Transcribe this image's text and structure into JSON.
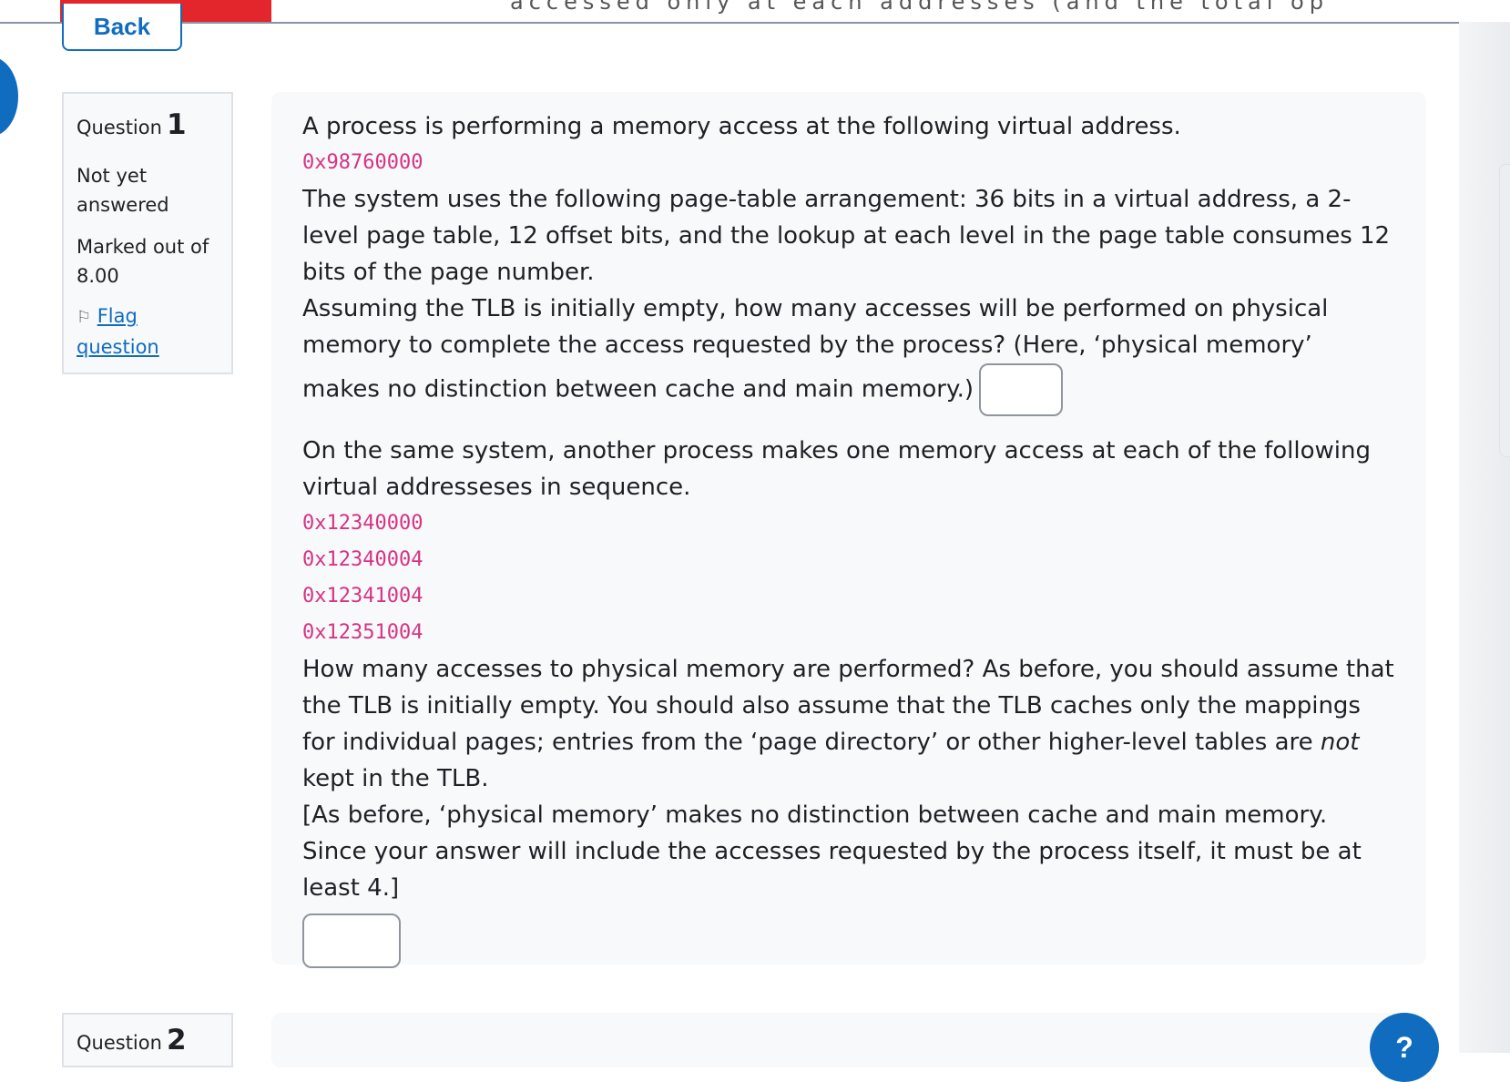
{
  "nav": {
    "back_label": "Back",
    "top_truncated_text": "accessed only at each addresses (and the total op"
  },
  "question1": {
    "label": "Question",
    "number": "1",
    "state": "Not yet answered",
    "grade": "Marked out of 8.00",
    "flag_label": "Flag question",
    "intro": "A process is performing a memory access at the following virtual address.",
    "address1": "0x98760000",
    "arrangement": "The system uses the following page-table arrangement: 36 bits in a virtual address, a 2-level page table, 12 offset bits, and the lookup at each level in the page table consumes 12 bits of the page number.",
    "assumption": "Assuming the TLB is initially empty, how many accesses will be performed on physical memory to complete the access requested by the process? (Here, ‘physical memory’ makes no distinction between cache and main memory.)",
    "answer1_value": "",
    "part2_intro": "On the same system, another process makes one memory access at each of the following virtual addresseses in sequence.",
    "addresses": [
      "0x12340000",
      "0x12340004",
      "0x12341004",
      "0x12351004"
    ],
    "how_many_pre": "How many accesses to physical memory are performed? As before, you should assume that the TLB is initially empty. You should also assume that the TLB caches only the mappings for individual pages; entries from the ‘page directory’ or other higher-level tables are ",
    "how_many_em": "not",
    "how_many_post": " kept in the TLB.",
    "note": "[As before, ‘physical memory’ makes no distinction between cache and main memory. Since your answer will include the accesses requested by the process itself, it must be at least 4.]",
    "answer2_value": ""
  },
  "question2": {
    "label": "Question",
    "number": "2"
  },
  "help": {
    "label": "?"
  }
}
